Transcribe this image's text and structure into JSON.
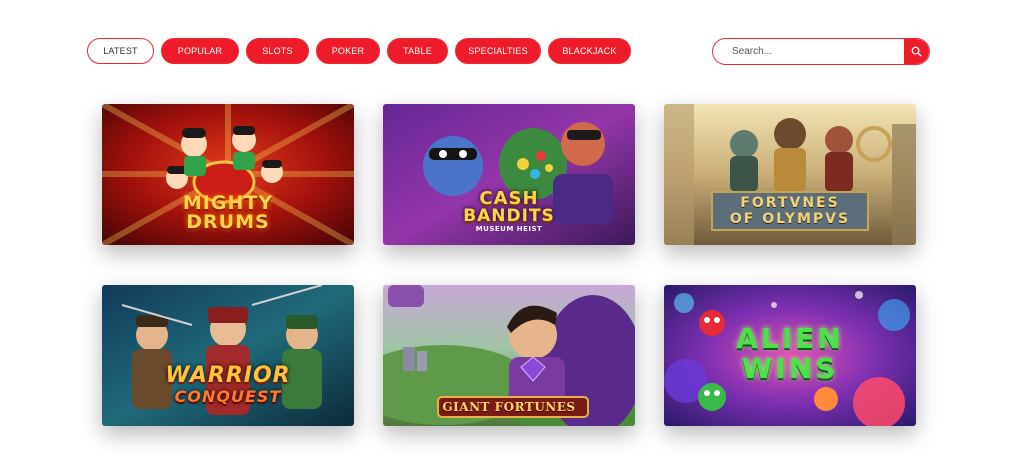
{
  "filters": {
    "latest": "LATEST",
    "popular": "POPULAR",
    "slots": "SLOTS",
    "poker": "POKER",
    "table": "TABLE",
    "specialties": "SPECIALTIES",
    "blackjack": "BLACKJACK",
    "active": "LATEST"
  },
  "search": {
    "placeholder": "Search..."
  },
  "colors": {
    "accent": "#ee1c2a"
  },
  "games": [
    {
      "title_line1": "MIGHTY",
      "title_line2": "DRUMS"
    },
    {
      "title_line1": "CASH",
      "title_line2": "BANDITS",
      "subtitle": "MUSEUM HEIST"
    },
    {
      "title_line1": "FORTVNES",
      "title_line2": "OF OLYMPVS"
    },
    {
      "title_line1": "WARRIOR",
      "title_line2": "CONQUEST"
    },
    {
      "title_line1": "GIANT FORTUNES"
    },
    {
      "title_line1": "ALIEN",
      "title_line2": "WINS"
    }
  ]
}
